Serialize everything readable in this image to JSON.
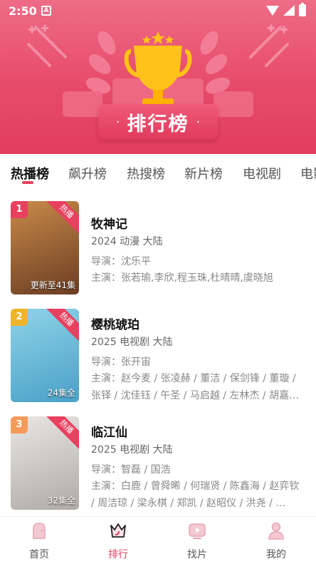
{
  "status_bar": {
    "time": "2:50",
    "notification_icon": "A"
  },
  "banner": {
    "title": "排行榜",
    "dot_left": "·",
    "dot_right": "·"
  },
  "tabs": [
    {
      "label": "热播榜",
      "active": true
    },
    {
      "label": "飙升榜",
      "active": false
    },
    {
      "label": "热搜榜",
      "active": false
    },
    {
      "label": "新片榜",
      "active": false
    },
    {
      "label": "电视剧",
      "active": false
    },
    {
      "label": "电影",
      "active": false
    }
  ],
  "items": [
    {
      "rank": "1",
      "rank_color": "#e8405f",
      "hot_label": "热播",
      "episodes": "更新至41集",
      "title": "牧神记",
      "meta": "2024  动漫  大陆",
      "director": "导演：沈乐平",
      "actors": "主演：张若瑜,李欣,程玉珠,杜晴晴,虞晓旭",
      "poster_colors": [
        "#c98a4a",
        "#6b3d22"
      ]
    },
    {
      "rank": "2",
      "rank_color": "#f0b429",
      "hot_label": "热播",
      "episodes": "24集全",
      "title": "樱桃琥珀",
      "meta": "2025  电视剧  大陆",
      "director": "导演：张开宙",
      "actors": "主演：赵今麦 / 张凌赫 / 董洁 / 保剑锋 / 董璇 / 张铎 / 沈佳钰 / 午圣 / 马启越 / 左林杰 / 胡嘉…",
      "poster_colors": [
        "#8fd3e8",
        "#4aa0c8"
      ]
    },
    {
      "rank": "3",
      "rank_color": "#f59b5a",
      "hot_label": "热播",
      "episodes": "32集全",
      "title": "临江仙",
      "meta": "2025  电视剧  大陆",
      "director": "导演：智磊 / 国浩",
      "actors": "主演：白鹿 / 曾舜晞 / 何瑞贤 / 陈鑫海 / 赵弈钦 / 周洁琼 / 梁永棋 / 郑凯 / 赵昭仪 / 洪尧 / …",
      "poster_colors": [
        "#e8e6e4",
        "#b0aaa8"
      ]
    }
  ],
  "bottom_nav": [
    {
      "label": "首页",
      "icon": "home-icon",
      "active": false
    },
    {
      "label": "排行",
      "icon": "crown-icon",
      "active": true
    },
    {
      "label": "找片",
      "icon": "play-search-icon",
      "active": false
    },
    {
      "label": "我的",
      "icon": "profile-icon",
      "active": false
    }
  ],
  "colors": {
    "accent": "#e8405f",
    "banner_top": "#ee6c86",
    "banner_bottom": "#e23d5f",
    "trophy": "#ffc21a"
  }
}
